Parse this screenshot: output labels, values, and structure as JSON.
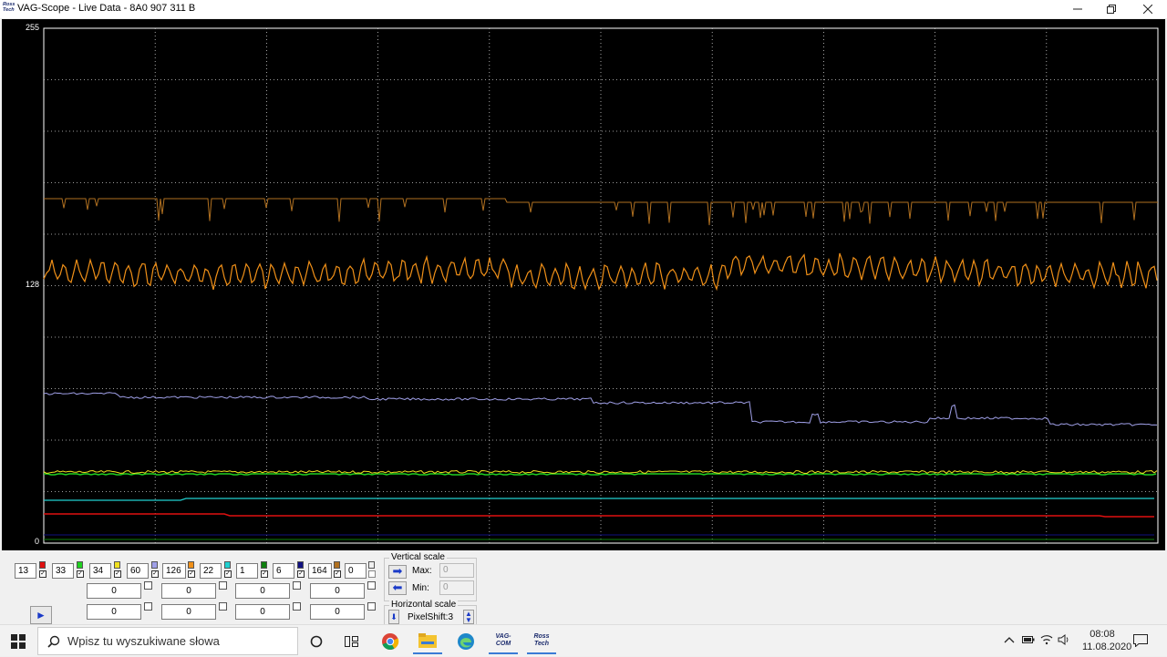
{
  "window": {
    "title": "VAG-Scope - Live Data - 8A0 907 311 B",
    "logo_top": "Ross",
    "logo_bottom": "Tech"
  },
  "scope": {
    "axis_labels": [
      "255",
      "128",
      "0"
    ],
    "background": "#000000",
    "grid_color": "#cfcfcf"
  },
  "channels": [
    {
      "value": "13",
      "color": "#e01010"
    },
    {
      "value": "33",
      "color": "#20d020"
    },
    {
      "value": "34",
      "color": "#f0e020"
    },
    {
      "value": "60",
      "color": "#a0a0e8"
    },
    {
      "value": "126",
      "color": "#f09018"
    },
    {
      "value": "22",
      "color": "#20d0d0"
    },
    {
      "value": "1",
      "color": "#108010"
    },
    {
      "value": "6",
      "color": "#101080"
    },
    {
      "value": "164",
      "color": "#b07020"
    },
    {
      "value": "0",
      "color": "#f0f0f0"
    }
  ],
  "offsets": [
    [
      "0",
      "0",
      "0",
      "0"
    ],
    [
      "0",
      "0",
      "0",
      "0"
    ]
  ],
  "vertical_scale": {
    "label": "Vertical scale",
    "max_label": "Max:",
    "min_label": "Min:",
    "max_value": "0",
    "min_value": "0"
  },
  "horizontal_scale": {
    "label": "Horizontal scale",
    "value": "PixelShift:3"
  },
  "taskbar": {
    "search_placeholder": "Wpisz tu wyszukiwane słowa",
    "time": "08:08",
    "date": "11.08.2020",
    "vag_icon_top": "VAG-",
    "vag_icon_bottom": "COM",
    "ross_icon_top": "Ross",
    "ross_icon_bottom": "Tech"
  }
}
